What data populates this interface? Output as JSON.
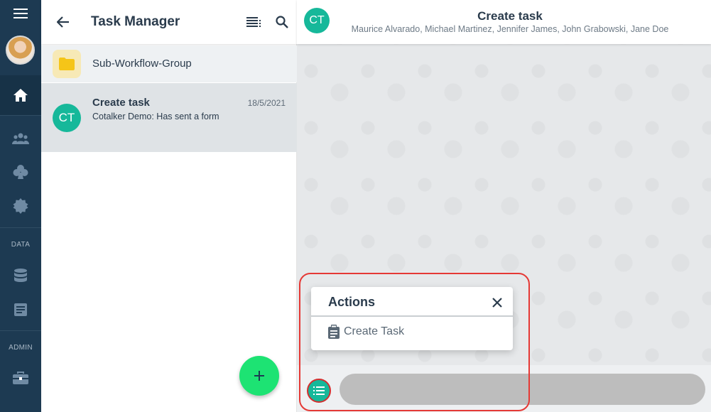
{
  "rail": {
    "icons": [
      "menu-icon",
      "home-icon",
      "groups-icon",
      "club-icon",
      "badge-icon",
      "database-icon",
      "document-icon",
      "toolbox-icon"
    ],
    "data_label": "DATA",
    "admin_label": "ADMIN"
  },
  "panel": {
    "title": "Task Manager",
    "folder": {
      "label": "Sub-Workflow-Group"
    },
    "task": {
      "avatar_initials": "CT",
      "title": "Create task",
      "date": "18/5/2021",
      "subtitle": "Cotalker Demo: Has sent a form"
    },
    "fab_label": "+"
  },
  "chat": {
    "avatar_initials": "CT",
    "title": "Create task",
    "members": "Maurice Alvarado, Michael Martinez, Jennifer James, John Grabowski, Jane Doe",
    "actions": {
      "title": "Actions",
      "close_symbol": "✕",
      "items": [
        {
          "label": "Create Task",
          "icon": "clipboard-icon"
        }
      ]
    }
  },
  "colors": {
    "rail_bg": "#1d3a52",
    "accent_teal": "#16b89a",
    "fab_green": "#1de373",
    "highlight_red": "#e53935"
  }
}
